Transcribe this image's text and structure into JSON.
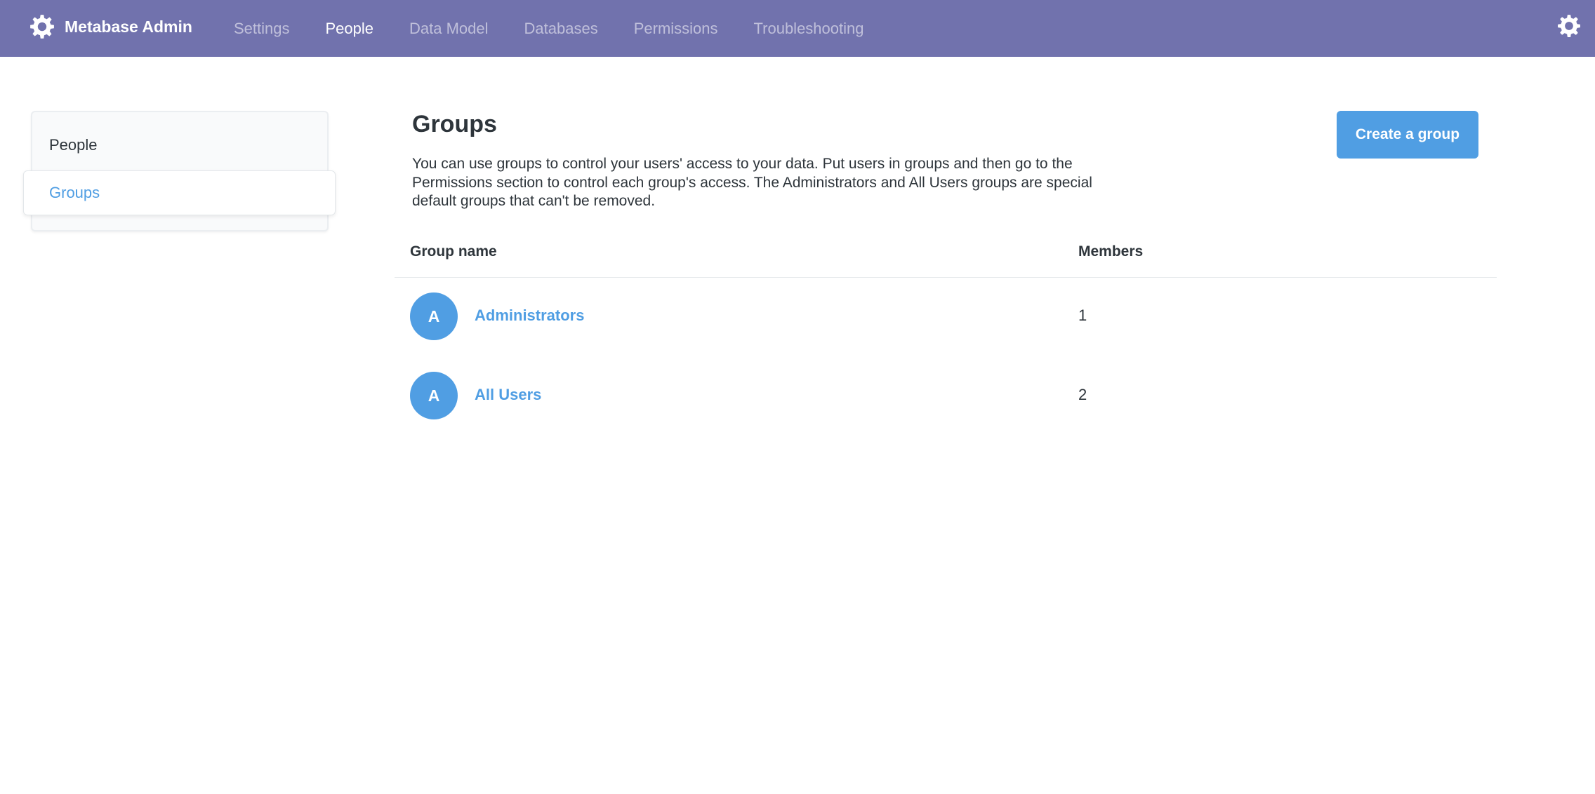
{
  "nav": {
    "brand": "Metabase Admin",
    "items": [
      {
        "label": "Settings",
        "active": false
      },
      {
        "label": "People",
        "active": true
      },
      {
        "label": "Data Model",
        "active": false
      },
      {
        "label": "Databases",
        "active": false
      },
      {
        "label": "Permissions",
        "active": false
      },
      {
        "label": "Troubleshooting",
        "active": false
      }
    ],
    "brand_icon": "gear-icon",
    "settings_icon": "gear-icon",
    "bg_color": "#7172ad"
  },
  "sidebar": {
    "items": [
      {
        "label": "People",
        "active": false
      },
      {
        "label": "Groups",
        "active": true
      }
    ]
  },
  "main": {
    "title": "Groups",
    "description": "You can use groups to control your users' access to your data. Put users in groups and then go to the Permissions section to control each group's access. The Administrators and All Users groups are special default groups that can't be removed.",
    "create_button": "Create a group",
    "accent_color": "#509ee3"
  },
  "table": {
    "columns": [
      "Group name",
      "Members"
    ],
    "rows": [
      {
        "avatar": "A",
        "name": "Administrators",
        "members": "1"
      },
      {
        "avatar": "A",
        "name": "All Users",
        "members": "2"
      }
    ]
  }
}
